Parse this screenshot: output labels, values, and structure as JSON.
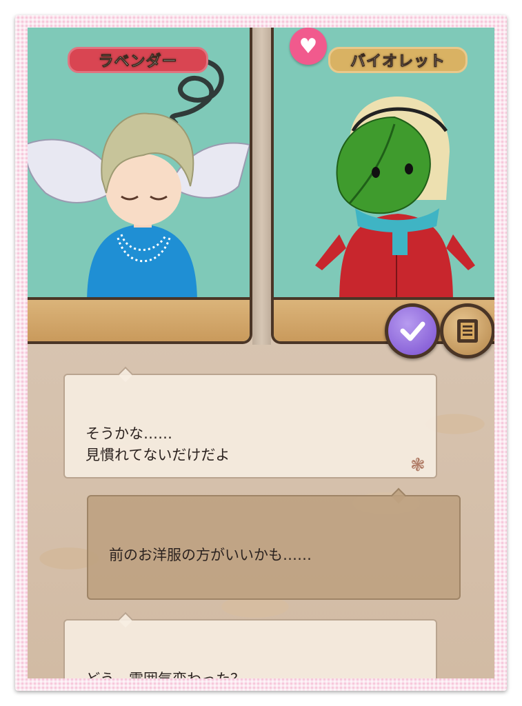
{
  "characters": {
    "left": {
      "name": "ラベンダー",
      "tag_color": "#d94552"
    },
    "right": {
      "name": "バイオレット",
      "tag_color": "#d9b263",
      "badge_icon": "heart-icon"
    }
  },
  "buttons": {
    "check": {
      "icon": "check-icon"
    },
    "album": {
      "icon": "album-icon"
    }
  },
  "dialogue": [
    {
      "speaker": "left",
      "text": "そうかな……\n見慣れてないだけだよ"
    },
    {
      "speaker": "right",
      "text": "前のお洋服の方がいいかも……"
    },
    {
      "speaker": "left",
      "text": "どう、雰囲気変わった？\n似合ってる？"
    }
  ]
}
